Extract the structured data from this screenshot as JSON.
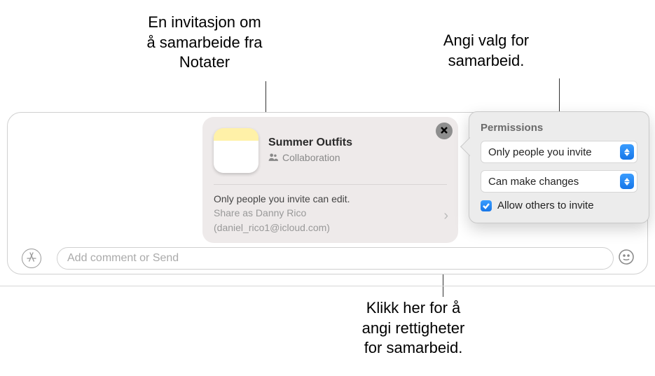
{
  "callouts": {
    "top_left": "En invitasjon om\nå samarbeide fra\nNotater",
    "top_right": "Angi valg for\nsamarbeid.",
    "bottom": "Klikk her for å\nangi rettigheter\nfor samarbeid."
  },
  "invite": {
    "title": "Summer Outfits",
    "mode": "Collaboration",
    "summary": "Only people you invite can edit.",
    "share_as_prefix": "Share as Danny Rico",
    "share_account": "(daniel_rico1@icloud.com)"
  },
  "permissions": {
    "heading": "Permissions",
    "who": "Only people you invite",
    "access": "Can make changes",
    "allow_others": "Allow others to invite",
    "allow_others_checked": true
  },
  "compose": {
    "placeholder": "Add comment or Send"
  }
}
